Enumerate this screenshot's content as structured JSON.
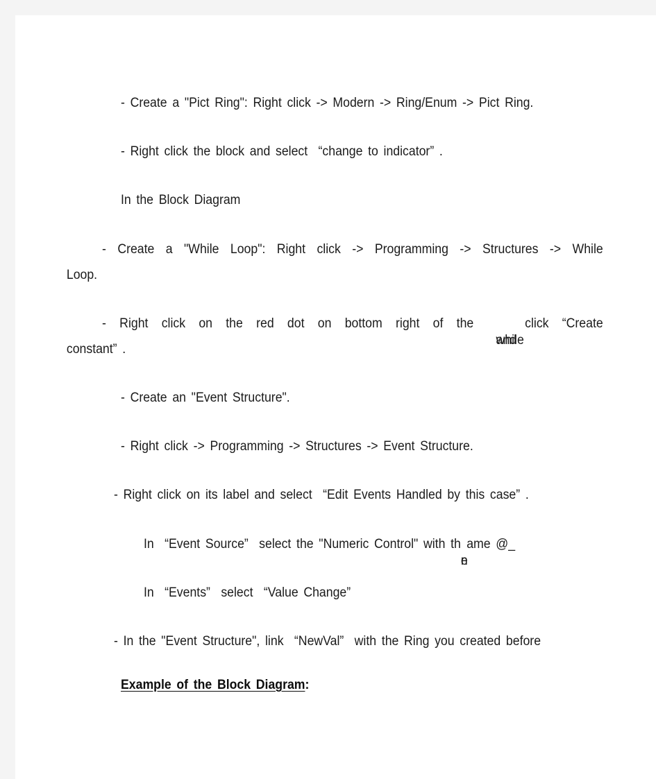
{
  "page": {
    "background_color": "#f4f4f4",
    "paper_color": "#ffffff",
    "text_color": "#1b1b1b"
  },
  "content": {
    "line_create_pict_ring": "- Create a \"Pict Ring\": Right click -> Modern -> Ring/Enum -> Pict Ring.",
    "line_change_to_indicator": "- Right click the block and select  “change to indicator” .",
    "section_block_diagram": "In the Block Diagram",
    "while_loop": {
      "line1": "- Create a \"While Loop\": Right click -> Programming -> Structures -> While",
      "line2": "Loop."
    },
    "red_dot": {
      "line1_prefix": "- Right click on the red dot on bottom right of the ",
      "line1_overlap_a": "while",
      "line1_overlap_b": "and",
      "line1_suffix": " click  “Create",
      "line2": "constant” ."
    },
    "line_create_event_structure": "- Create an \"Event Structure\".",
    "line_right_click_path": "- Right click -> Programming -> Structures -> Event Structure.",
    "line_edit_events": "- Right click on its label and select  “Edit Events Handled by this case” .",
    "event_source": {
      "prefix": "In  “Event Source”  select the \"Numeric Control\" with th",
      "overlap_a": "e",
      "overlap_b": "n",
      "suffix": "ame @_"
    },
    "line_events_value_change": "In  “Events”  select  “Value Change”",
    "line_newval_link": "- In the \"Event Structure\", link  “NewVal”  with the Ring you created before",
    "heading_example": {
      "underlined": "Example of the Block Diagram",
      "trailing": ":"
    }
  }
}
